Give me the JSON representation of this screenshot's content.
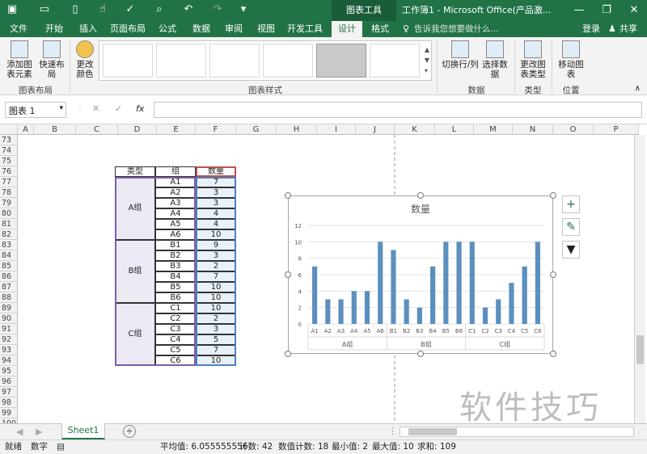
{
  "title_bar": {
    "context_tab": "图表工具",
    "window_title": "工作簿1 - Microsoft Office(产品激...",
    "minimize": "—",
    "restore": "❐",
    "close": "✕"
  },
  "tabs": [
    {
      "label": "文件"
    },
    {
      "label": "开始"
    },
    {
      "label": "插入"
    },
    {
      "label": "页面布局"
    },
    {
      "label": "公式"
    },
    {
      "label": "数据"
    },
    {
      "label": "审阅"
    },
    {
      "label": "视图"
    },
    {
      "label": "开发工具"
    },
    {
      "label": "设计"
    },
    {
      "label": "格式"
    }
  ],
  "tell_me": "告诉我您想要做什么...",
  "login": "登录",
  "share": "共享",
  "ribbon": {
    "add_element": "添加图表元素",
    "quick_layout": "快速布局",
    "change_color": "更改颜色",
    "group_layout": "图表布局",
    "group_styles": "图表样式",
    "switch_rowcol": "切换行/列",
    "select_data": "选择数据",
    "group_data": "数据",
    "change_type": "更改图表类型",
    "group_type": "类型",
    "move_chart": "移动图表",
    "group_location": "位置"
  },
  "formula_bar": {
    "name_box": "图表 1",
    "cancel_icon": "✕",
    "enter_icon": "✓",
    "fx": "fx",
    "value": ""
  },
  "columns": [
    "A",
    "B",
    "C",
    "D",
    "E",
    "F",
    "G",
    "H",
    "I",
    "J",
    "K",
    "L",
    "M",
    "N",
    "O",
    "P"
  ],
  "rows": [
    "73",
    "74",
    "75",
    "76",
    "77",
    "78",
    "79",
    "80",
    "81",
    "82",
    "83",
    "84",
    "85",
    "86",
    "87",
    "88",
    "89",
    "90",
    "91",
    "92",
    "93",
    "94",
    "95",
    "96",
    "97",
    "98",
    "99",
    "100"
  ],
  "table": {
    "headers": [
      "类型",
      "组",
      "数量"
    ],
    "groups": [
      {
        "name": "A组",
        "items": [
          [
            "A1",
            "7"
          ],
          [
            "A2",
            "3"
          ],
          [
            "A3",
            "3"
          ],
          [
            "A4",
            "4"
          ],
          [
            "A5",
            "4"
          ],
          [
            "A6",
            "10"
          ]
        ]
      },
      {
        "name": "B组",
        "items": [
          [
            "B1",
            "9"
          ],
          [
            "B2",
            "3"
          ],
          [
            "B3",
            "2"
          ],
          [
            "B4",
            "7"
          ],
          [
            "B5",
            "10"
          ],
          [
            "B6",
            "10"
          ]
        ]
      },
      {
        "name": "C组",
        "items": [
          [
            "C1",
            "10"
          ],
          [
            "C2",
            "2"
          ],
          [
            "C3",
            "3"
          ],
          [
            "C4",
            "5"
          ],
          [
            "C5",
            "7"
          ],
          [
            "C6",
            "10"
          ]
        ]
      }
    ]
  },
  "chart_data": {
    "type": "bar",
    "title": "数量",
    "categories": [
      "A1",
      "A2",
      "A3",
      "A4",
      "A5",
      "A6",
      "B1",
      "B2",
      "B3",
      "B4",
      "B5",
      "B6",
      "C1",
      "C2",
      "C3",
      "C4",
      "C5",
      "C6"
    ],
    "group_labels": [
      "A组",
      "B组",
      "C组"
    ],
    "values": [
      7,
      3,
      3,
      4,
      4,
      10,
      9,
      3,
      2,
      7,
      10,
      10,
      10,
      2,
      3,
      5,
      7,
      10
    ],
    "ylim": [
      0,
      12
    ],
    "yticks": [
      0,
      2,
      4,
      6,
      8,
      10,
      12
    ],
    "grid": true,
    "bar_color": "#5b8fbf"
  },
  "chart_side": {
    "add_icon": "+",
    "brush_icon": "✎",
    "filter_icon": "▼"
  },
  "sheet_tab": "Sheet1",
  "add_sheet": "+",
  "status_bar": {
    "ready": "就绪",
    "mode": "数字",
    "average": "平均值: 6.055555556",
    "count": "计数: 42",
    "numeric_count": "数值计数: 18",
    "min": "最小值: 2",
    "max": "最大值: 10",
    "sum": "求和: 109"
  },
  "watermark": "软件技巧"
}
